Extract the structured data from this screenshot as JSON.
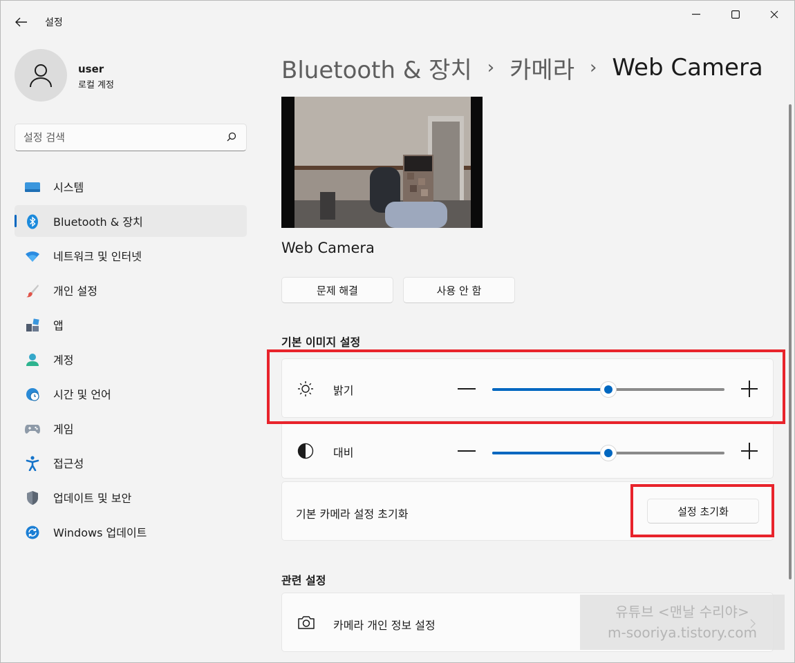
{
  "titlebar": {
    "app_title": "설정",
    "back_icon": "back-arrow-icon",
    "minimize_icon": "minimize-icon",
    "maximize_icon": "maximize-icon",
    "close_icon": "close-icon"
  },
  "user": {
    "name": "user",
    "account_type": "로컬 계정"
  },
  "search": {
    "placeholder": "설정 검색"
  },
  "sidebar": {
    "items": [
      {
        "label": "시스템",
        "icon": "system-icon",
        "active": false
      },
      {
        "label": "Bluetooth & 장치",
        "icon": "bluetooth-icon",
        "active": true
      },
      {
        "label": "네트워크 및 인터넷",
        "icon": "wifi-icon",
        "active": false
      },
      {
        "label": "개인 설정",
        "icon": "brush-icon",
        "active": false
      },
      {
        "label": "앱",
        "icon": "apps-icon",
        "active": false
      },
      {
        "label": "계정",
        "icon": "account-icon",
        "active": false
      },
      {
        "label": "시간 및 언어",
        "icon": "globe-clock-icon",
        "active": false
      },
      {
        "label": "게임",
        "icon": "gamepad-icon",
        "active": false
      },
      {
        "label": "접근성",
        "icon": "accessibility-icon",
        "active": false
      },
      {
        "label": "업데이트 및 보안",
        "icon": "shield-icon",
        "active": false
      },
      {
        "label": "Windows 업데이트",
        "icon": "windows-update-icon",
        "active": false
      }
    ]
  },
  "breadcrumb": {
    "part1": "Bluetooth & 장치",
    "part2": "카메라",
    "current": "Web Camera",
    "separator": "›"
  },
  "camera": {
    "name": "Web Camera",
    "troubleshoot_label": "문제 해결",
    "disable_label": "사용 안 함"
  },
  "basic_image": {
    "section_title": "기본 이미지 설정",
    "brightness": {
      "label": "밝기",
      "icon": "brightness-icon",
      "value": 0.5
    },
    "contrast": {
      "label": "대비",
      "icon": "contrast-icon",
      "value": 0.5
    },
    "reset_text": "기본 카메라 설정 초기화",
    "reset_button": "설정 초기화"
  },
  "related": {
    "section_title": "관련 설정",
    "privacy_label": "카메라 개인 정보 설정",
    "privacy_icon": "camera-icon"
  },
  "watermark": {
    "line1": "유튜브 <맨날 수리야>",
    "line2": "m-sooriya.tistory.com"
  },
  "colors": {
    "accent": "#0067c0",
    "highlight": "#e8232b"
  }
}
